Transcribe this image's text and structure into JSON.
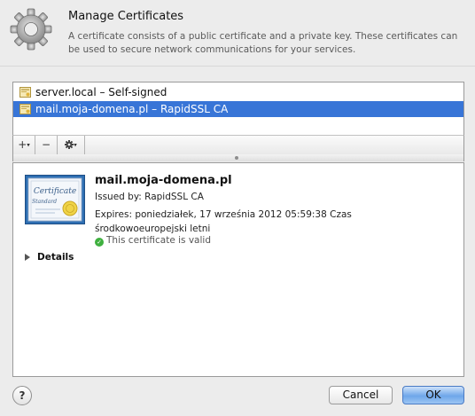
{
  "dialog": {
    "title": "Manage Certificates",
    "description": "A certificate consists of a public certificate and a private key. These certificates can be used to secure network communications for your services.",
    "icon": "gear-icon"
  },
  "certificates": [
    {
      "label": "server.local – Self-signed",
      "selected": false,
      "icon": "certificate-icon"
    },
    {
      "label": "mail.moja-domena.pl – RapidSSL CA",
      "selected": true,
      "icon": "certificate-icon"
    }
  ],
  "toolbar": {
    "add": "+",
    "add_menu": "▾",
    "remove": "−",
    "action_menu": "▾",
    "action_icon": "gear-icon"
  },
  "detail": {
    "name": "mail.moja-domena.pl",
    "issued_by": "Issued by: RapidSSL CA",
    "expires": "Expires: poniedziałek, 17 września 2012 05:59:38 Czas środkowoeuropejski letni",
    "valid": "This certificate is valid",
    "valid_mark": "✓",
    "details_label": "Details",
    "cert_title": "Certificate",
    "cert_subtitle": "Standard"
  },
  "buttons": {
    "help": "?",
    "cancel": "Cancel",
    "ok": "OK"
  },
  "colors": {
    "selection": "#3875d7",
    "valid_green": "#3fb03f",
    "ok_blue": "#6ea6ea"
  }
}
